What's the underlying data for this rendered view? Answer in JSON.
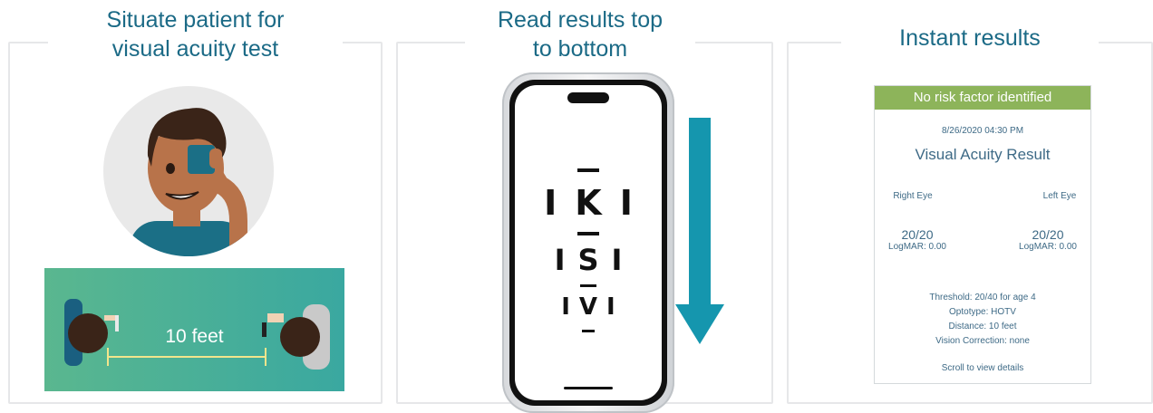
{
  "panels": {
    "setup": {
      "title_line1": "Situate patient for",
      "title_line2": "visual acuity test",
      "distance_label": "10 feet"
    },
    "read": {
      "title_line1": "Read results top",
      "title_line2": "to bottom",
      "chart_rows": [
        "IKI",
        "ISI",
        "IVI"
      ]
    },
    "results": {
      "title": "Instant results",
      "card": {
        "banner": "No risk factor identified",
        "timestamp": "8/26/2020 04:30 PM",
        "heading": "Visual Acuity Result",
        "right_eye_label": "Right Eye",
        "left_eye_label": "Left Eye",
        "right_value": "20/20",
        "right_logmar": "LogMAR: 0.00",
        "left_value": "20/20",
        "left_logmar": "LogMAR: 0.00",
        "threshold": "Threshold: 20/40 for age 4",
        "optotype": "Optotype: HOTV",
        "distance": "Distance: 10 feet",
        "correction": "Vision Correction: none",
        "scroll_link": "Scroll to view details"
      }
    }
  },
  "colors": {
    "title": "#1b6a86",
    "banner": "#8db45a",
    "arrow": "#1596ae",
    "skin": "#b8734a",
    "shirt": "#1b6f86",
    "hair": "#3a2418",
    "gradient_start": "#5ab78f",
    "gradient_end": "#3aa8a0",
    "measure_line": "#f2e58c"
  }
}
